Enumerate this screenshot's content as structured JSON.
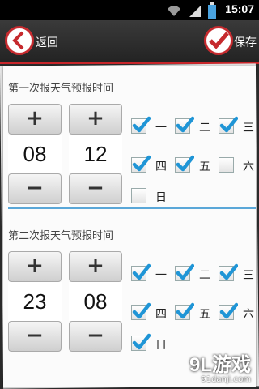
{
  "status_bar": {
    "time": "15:07"
  },
  "header": {
    "back_label": "返回",
    "save_label": "保存"
  },
  "sections": [
    {
      "title": "第一次报天气预报时间",
      "hour": "08",
      "minute": "12",
      "days": [
        {
          "label": "一",
          "checked": true
        },
        {
          "label": "二",
          "checked": true
        },
        {
          "label": "三",
          "checked": true
        },
        {
          "label": "四",
          "checked": true
        },
        {
          "label": "五",
          "checked": true
        },
        {
          "label": "六",
          "checked": false
        },
        {
          "label": "日",
          "checked": false
        }
      ]
    },
    {
      "title": "第二次报天气预报时间",
      "hour": "23",
      "minute": "08",
      "days": [
        {
          "label": "一",
          "checked": true
        },
        {
          "label": "二",
          "checked": true
        },
        {
          "label": "三",
          "checked": true
        },
        {
          "label": "四",
          "checked": true
        },
        {
          "label": "五",
          "checked": true
        },
        {
          "label": "六",
          "checked": true
        },
        {
          "label": "日",
          "checked": true
        }
      ]
    }
  ],
  "buttons": {
    "plus": "+",
    "minus": "−"
  },
  "watermark": {
    "logo": "9L游戏",
    "url": "91danji.com"
  }
}
